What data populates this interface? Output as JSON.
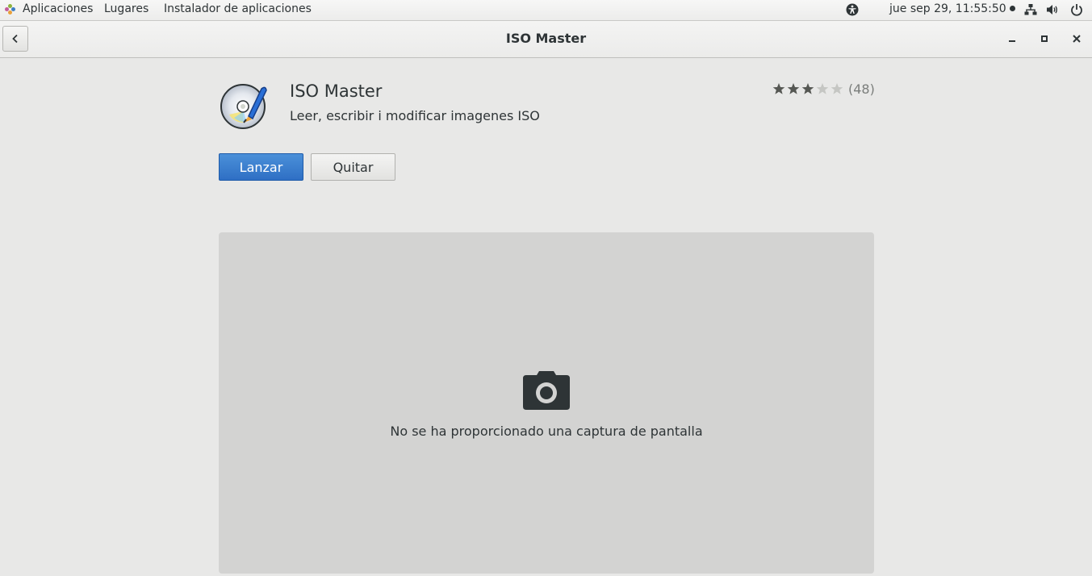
{
  "topbar": {
    "menus": [
      "Aplicaciones",
      "Lugares",
      "Instalador de aplicaciones"
    ],
    "clock": "jue sep 29, 11:55:50",
    "icons": [
      "accessibility-icon",
      "network-icon",
      "volume-icon",
      "power-icon"
    ]
  },
  "window": {
    "title": "ISO Master",
    "controls": [
      "minimize-icon",
      "maximize-icon",
      "close-icon"
    ]
  },
  "app": {
    "name": "ISO Master",
    "summary": "Leer, escribir i modificar imagenes ISO",
    "rating_stars": 3,
    "rating_max": 5,
    "review_count": "(48)",
    "launch_label": "Lanzar",
    "remove_label": "Quitar"
  },
  "screenshot_area": {
    "message": "No se ha proporcionado una captura de pantalla",
    "icon": "camera-icon"
  },
  "colors": {
    "accent": "#3a80d2",
    "background": "#e8e8e7",
    "placeholder_bg": "#d3d3d2"
  }
}
